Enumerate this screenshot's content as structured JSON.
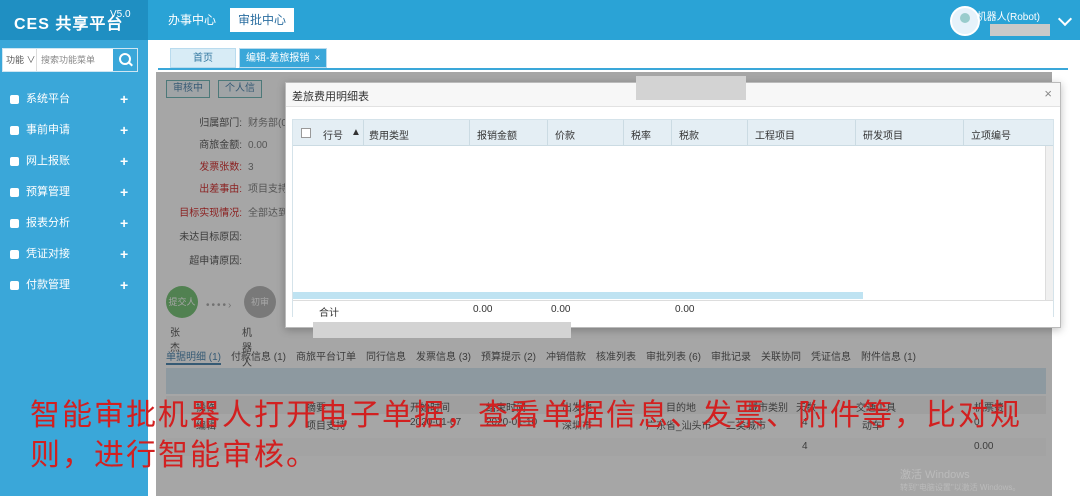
{
  "app": {
    "logo_name": "CES 共享平台",
    "version": "V5.0",
    "top_nav": [
      "办事中心",
      "审批中心"
    ],
    "user_name": "机器人(Robot)"
  },
  "sidebar": {
    "search_select": "功能 ∨",
    "search_placeholder": "搜索功能菜单",
    "items": [
      {
        "label": "系统平台"
      },
      {
        "label": "事前申请"
      },
      {
        "label": "网上报账"
      },
      {
        "label": "预算管理"
      },
      {
        "label": "报表分析"
      },
      {
        "label": "凭证对接"
      },
      {
        "label": "付款管理"
      }
    ]
  },
  "tabs": {
    "home": "首页",
    "edit": "编辑-差旅报销",
    "close": "×"
  },
  "toolbar": {
    "review": "审核中",
    "personal": "个人信"
  },
  "form": {
    "dept_label": "归属部门:",
    "dept_value": "财务部(0",
    "amount_label": "商旅金额:",
    "amount_value": "0.00",
    "invoice_label": "发票张数:",
    "invoice_value": "3",
    "reason_label": "出差事由:",
    "reason_value": "项目支持",
    "target_label": "目标实现情况:",
    "target_value": "全部达到",
    "unmet_label": "未达目标原因:",
    "over_label": "超申请原因:"
  },
  "flow": {
    "node1": "提交人",
    "node1_name": "张杰",
    "node2": "初审",
    "node2_name": "机器人"
  },
  "subtabs": [
    "单据明细 (1)",
    "付款信息 (1)",
    "商旅平台订单",
    "同行信息",
    "发票信息 (3)",
    "预算提示 (2)",
    "冲销借款",
    "核准列表",
    "审批列表 (6)",
    "审批记录",
    "关联协同",
    "凭证信息",
    "附件信息 (1)"
  ],
  "detail_table": {
    "headers": [
      "操作",
      "摘要",
      "开始时间",
      "结束时间",
      "出发地",
      "目的地",
      "城市类别",
      "天数",
      "交通工具",
      "机票费"
    ],
    "row": [
      "编辑",
      "项目支持",
      "2020-01-07",
      "2020-01-10",
      "深圳市",
      "广东省_汕头市",
      "二类城市",
      "4",
      "动车",
      "0"
    ],
    "total_days": "4",
    "total_fee": "0.00"
  },
  "modal": {
    "title": "差旅费用明细表",
    "close": "×",
    "columns": [
      "行号",
      "费用类型",
      "报销金额",
      "价款",
      "税率",
      "税款",
      "工程项目",
      "研发项目",
      "立项编号"
    ],
    "footer_label": "合计",
    "footer_values": [
      "0.00",
      "0.00",
      "0.00"
    ]
  },
  "caption": "智能审批机器人打开电子单据，查看单据信息、发票、附件等，比对规则，进行智能审核。",
  "watermark": "激活 Windows",
  "watermark_sub": "转到\"电脑设置\"以激活 Windows。"
}
